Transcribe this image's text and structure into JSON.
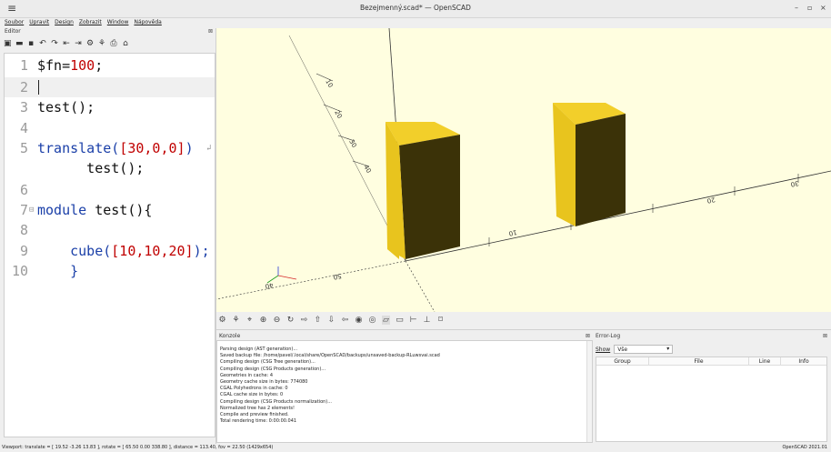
{
  "window": {
    "title": "Bezejmenný.scad* — OpenSCAD"
  },
  "menu": [
    "Soubor",
    "Upravit",
    "Design",
    "Zobrazit",
    "Window",
    "Nápověda"
  ],
  "editor": {
    "label": "Editor",
    "lines": [
      {
        "n": "1",
        "parts": [
          {
            "t": "$fn=",
            "c": "plain"
          },
          {
            "t": "100",
            "c": "num"
          },
          {
            "t": ";",
            "c": "plain"
          }
        ]
      },
      {
        "n": "2",
        "parts": []
      },
      {
        "n": "3",
        "parts": [
          {
            "t": "test();",
            "c": "plain"
          }
        ]
      },
      {
        "n": "4",
        "parts": []
      },
      {
        "n": "5",
        "parts": [
          {
            "t": "translate(",
            "c": "kw"
          },
          {
            "t": "[30,0,0]",
            "c": "num"
          },
          {
            "t": ")",
            "c": "kw"
          }
        ]
      },
      {
        "n": "",
        "parts": [
          {
            "t": "      test();",
            "c": "plain"
          }
        ]
      },
      {
        "n": "6",
        "parts": []
      },
      {
        "n": "7",
        "parts": [
          {
            "t": "module",
            "c": "kw"
          },
          {
            "t": " test(){",
            "c": "plain"
          }
        ]
      },
      {
        "n": "8",
        "parts": []
      },
      {
        "n": "9",
        "parts": [
          {
            "t": "    ",
            "c": "plain"
          },
          {
            "t": "cube(",
            "c": "kw"
          },
          {
            "t": "[10,10,20]",
            "c": "num"
          },
          {
            "t": ");",
            "c": "kw"
          }
        ]
      },
      {
        "n": "10",
        "parts": [
          {
            "t": "    }",
            "c": "kw"
          }
        ]
      }
    ]
  },
  "console": {
    "label": "Konzole",
    "lines": [
      "Parsing design (AST generation)...",
      "Saved backup file: /home/pavel/.local/share/OpenSCAD/backups/unsaved-backup-RLuwsvai.scad",
      "Compiling design (CSG Tree generation)...",
      "Compiling design (CSG Products generation)...",
      "Geometries in cache: 4",
      "Geometry cache size in bytes: 774080",
      "CGAL Polyhedrons in cache: 0",
      "CGAL cache size in bytes: 0",
      "Compiling design (CSG Products normalization)...",
      "Normalized tree has 2 elements!",
      "Compile and preview finished.",
      "Total rendering time: 0:00:00.041"
    ]
  },
  "errorlog": {
    "label": "Error-Log",
    "show_label": "Show",
    "show_value": "Vše",
    "columns": [
      "Group",
      "File",
      "Line",
      "Info"
    ]
  },
  "viewport": {
    "axis_labels": [
      "10",
      "20",
      "30",
      "40",
      "50",
      "60",
      "10",
      "20",
      "30",
      "40",
      "50",
      "20",
      "10"
    ],
    "background": "#fffee0",
    "cube_top": "#f2cf2a",
    "cube_side": "#3b3208",
    "cube_front": "#e8c41e"
  },
  "status": {
    "left": "Viewport: translate = [ 19.52 -3.26 13.83 ], rotate = [ 65.50 0.00 338.80 ], distance = 113.40, fov = 22.50 (1429x654)",
    "right": "OpenSCAD 2021.01"
  }
}
